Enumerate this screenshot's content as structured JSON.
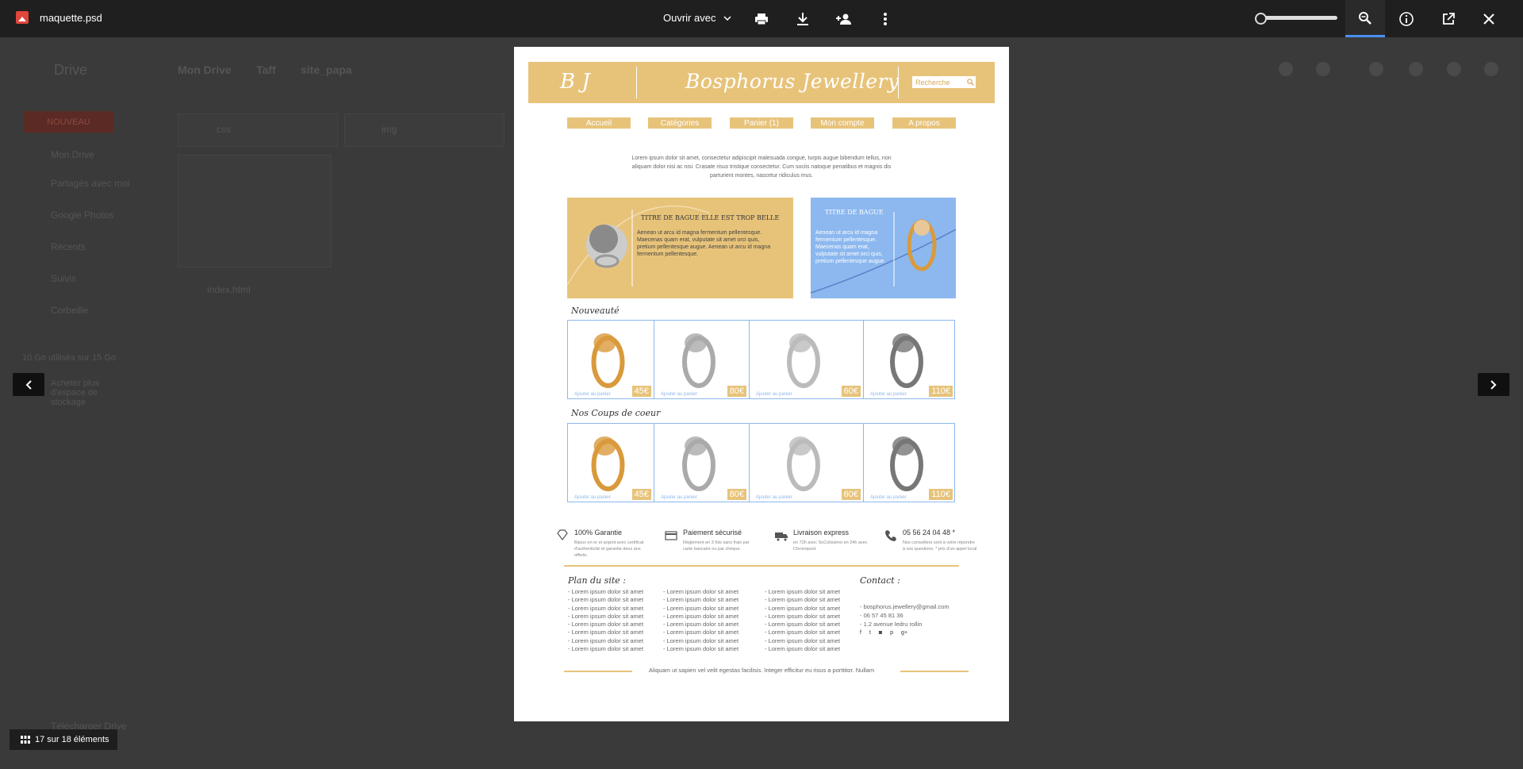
{
  "toolbar": {
    "file_name": "maquette.psd",
    "open_with": "Ouvrir avec",
    "icons": [
      "print-icon",
      "download-icon",
      "add-person-icon",
      "more-vert-icon",
      "zoom-icon",
      "info-icon",
      "open-external-icon",
      "close-icon"
    ],
    "zoom_level": 0
  },
  "background": {
    "drive_label": "Drive",
    "breadcrumb": [
      "Mon Drive",
      "Taff",
      "site_papa"
    ],
    "new_button": "NOUVEAU",
    "nav": [
      "Mon Drive",
      "Partagés avec moi",
      "Google Photos",
      "Récents",
      "Suivis",
      "Corbeille"
    ],
    "storage": "10 Go utilisés sur 15 Go",
    "buy_storage": "Acheter plus d'espace de stockage",
    "folders": [
      "css",
      "img"
    ],
    "file": "index.html",
    "download": "Télécharger Drive"
  },
  "counter": "17 sur 18 éléments",
  "mockup": {
    "logo": "B J",
    "brand": "Bosphorus Jewellery",
    "search_placeholder": "Recherche",
    "menu": [
      "Accueil",
      "Catégories",
      "Panier (1)",
      "Mon compte",
      "A propos"
    ],
    "intro": "Lorem ipsum dolor sit amet, consectetur adipiscipit malesuada congue, turpis augue bibendum tellus, non aliquam dolor nisi ac nisi. Crasate risus tristique consectetur. Cum sociis natoque penatibus et magnis dis parturient montes, nascetur ridiculus mus.",
    "banner1": {
      "title": "Titre de bague elle est trop belle",
      "text": "Aenean ut arcu id magna fermentum pellentesque. Maecenas quam erat, vulputate sit amet orci quis, pretium pellentesque augue. Aenean ut arcu id magna fermentum pellentesque."
    },
    "banner2": {
      "title": "Titre de bague",
      "text": "Aenean ut arcu id magna fermentum pellentesque. Maecenas quam erat, vulputate sit amet orci quis, pretium pellentesque augue."
    },
    "section_new": "Nouveauté",
    "section_fav": "Nos Coups de coeur",
    "add_to_cart": "Ajouter au panier",
    "products_new": [
      {
        "price": "45€",
        "color": "#d99a3c"
      },
      {
        "price": "80€",
        "color": "#aaaaaa"
      },
      {
        "price": "60€",
        "color": "#bbbbbb"
      },
      {
        "price": "110€",
        "color": "#777777"
      }
    ],
    "products_fav": [
      {
        "price": "45€",
        "color": "#d99a3c"
      },
      {
        "price": "80€",
        "color": "#aaaaaa"
      },
      {
        "price": "60€",
        "color": "#bbbbbb"
      },
      {
        "price": "110€",
        "color": "#777777"
      }
    ],
    "features": [
      {
        "title": "100% Garantie",
        "sub": "Bijoux en or et argent avec certificat d'authenticité et garantie deux ans offerte."
      },
      {
        "title": "Paiement sécurisé",
        "sub": "Règlement en 3 fois sans frais par carte bancaire ou par chèque."
      },
      {
        "title": "Livraison express",
        "sub": "en 72h avec SoColissimo en 24h avec Chronopost"
      },
      {
        "title": "05 56 24 04 48 *",
        "sub": "Nos conseillers sont à votre répondre à vos questions. * prix d'un appel local"
      }
    ],
    "sitemap_title": "Plan du site :",
    "sitemap_item": "- Lorem ipsum dolor sit amet",
    "contact_title": "Contact :",
    "contact": [
      "- bosphorus.jewellery@gmail.com",
      "- 06 57 45 81 36",
      "- 1.2 avenue ledru rollin"
    ],
    "socials": [
      "f",
      "t",
      "◙",
      "p",
      "g+"
    ],
    "footer": "Aliquam ut sapien vel velit egestas facilisis. Integer efficitur eu risus a porttitor. Nullam"
  },
  "colors": {
    "gold": "#e7c37a",
    "blue": "#8cb8ef",
    "accent": "#4a8ff0"
  }
}
